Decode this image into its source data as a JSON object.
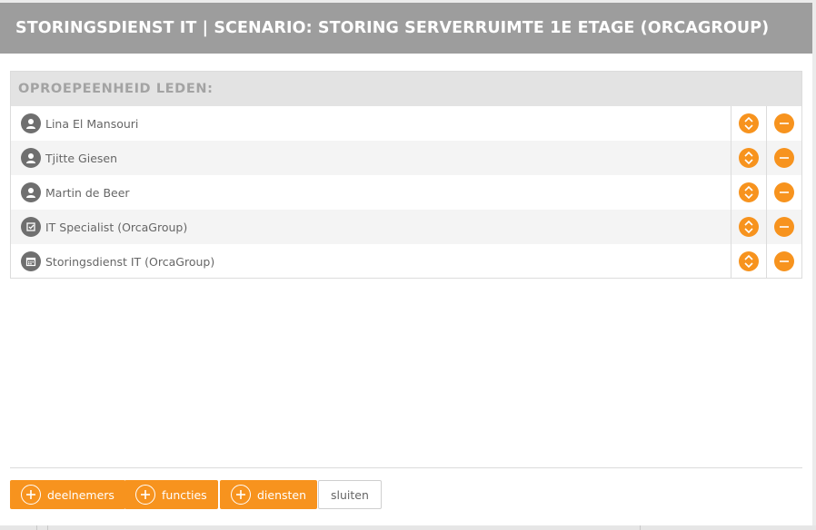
{
  "header": {
    "title": "STORINGSDIENST IT | SCENARIO: STORING SERVERRUIMTE 1E ETAGE (ORCAGROUP)"
  },
  "panel": {
    "title": "OPROEPEENHEID LEDEN:",
    "rows": [
      {
        "label": "Lina El Mansouri",
        "icon": "user-icon"
      },
      {
        "label": "Tjitte Giesen",
        "icon": "user-icon"
      },
      {
        "label": "Martin de Beer",
        "icon": "user-icon"
      },
      {
        "label": "IT Specialist (OrcaGroup)",
        "icon": "function-icon"
      },
      {
        "label": "Storingsdienst IT (OrcaGroup)",
        "icon": "calendar-icon"
      }
    ]
  },
  "footer": {
    "add_participants": "deelnemers",
    "add_functions": "functies",
    "add_services": "diensten",
    "close": "sluiten"
  },
  "colors": {
    "accent": "#f7931e",
    "header_bg": "#9d9d9d",
    "icon_bg": "#6f6f6f"
  }
}
